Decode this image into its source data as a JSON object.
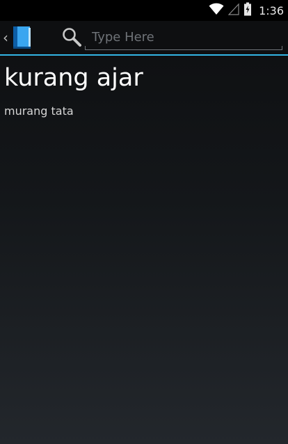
{
  "status_bar": {
    "time": "1:36",
    "icons": [
      "wifi-icon",
      "cell-signal-icon",
      "battery-charging-icon"
    ]
  },
  "action_bar": {
    "up_caret": "‹",
    "app_icon": "book-icon",
    "search_icon": "search-icon",
    "search": {
      "placeholder": "Type Here",
      "value": ""
    }
  },
  "accent_color": "#33b5e5",
  "entry": {
    "word": "kurang ajar",
    "definition": "murang tata"
  }
}
